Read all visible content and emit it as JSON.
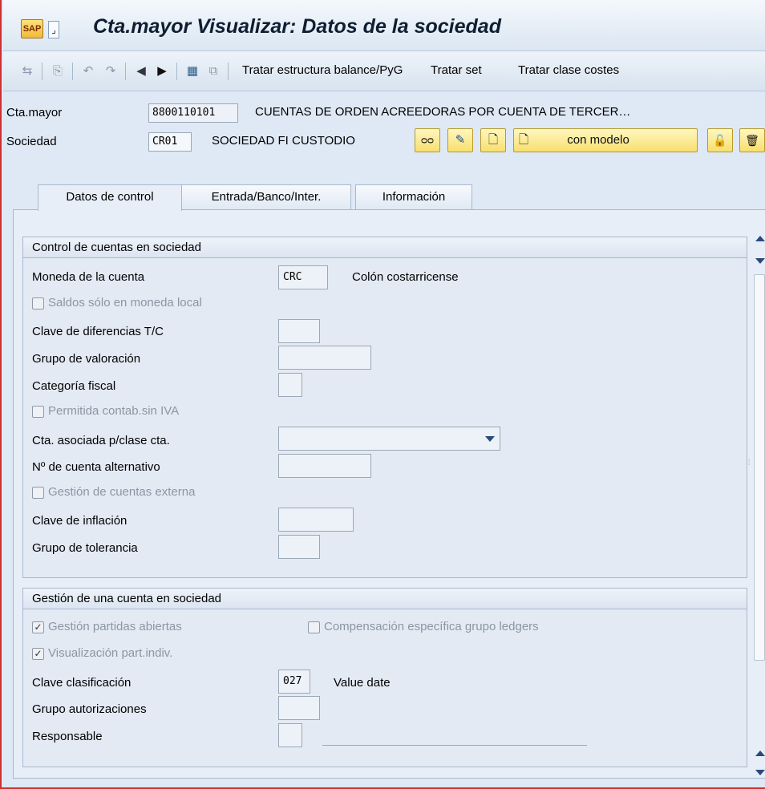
{
  "window": {
    "title_icon_text": "SAP",
    "title": "Cta.mayor Visualizar: Datos de la sociedad"
  },
  "toolbar": {
    "items": [
      "Tratar estructura balance/PyG",
      "Tratar set",
      "Tratar clase costes"
    ]
  },
  "header": {
    "account_label": "Cta.mayor",
    "account_value": "8800110101",
    "account_desc": "CUENTAS DE ORDEN ACREEDORAS POR CUENTA DE TERCER…",
    "company_label": "Sociedad",
    "company_value": "CR01",
    "company_desc": "SOCIEDAD FI CUSTODIO",
    "with_template_label": "con modelo"
  },
  "tabs": [
    {
      "label": "Datos de control"
    },
    {
      "label": "Entrada/Banco/Inter."
    },
    {
      "label": "Información"
    }
  ],
  "control_group": {
    "title": "Control de cuentas en sociedad",
    "currency_label": "Moneda de la cuenta",
    "currency_value": "CRC",
    "currency_desc": "Colón costarricense",
    "local_only_label": "Saldos sólo en moneda local",
    "exch_diff_label": "Clave de diferencias T/C",
    "valuation_label": "Grupo de valoración",
    "tax_cat_label": "Categoría fiscal",
    "no_tax_label": "Permitida contab.sin IVA",
    "recon_label": "Cta. asociada p/clase cta.",
    "alt_account_label": "Nº de cuenta alternativo",
    "ext_mgmt_label": "Gestión de cuentas externa",
    "inflation_label": "Clave de inflación",
    "tolerance_label": "Grupo de tolerancia"
  },
  "mgmt_group": {
    "title": "Gestión de una cuenta en sociedad",
    "open_items_label": "Gestión partidas abiertas",
    "open_items_checked": true,
    "ledger_comp_label": "Compensación específica grupo ledgers",
    "ledger_comp_checked": false,
    "line_items_label": "Visualización part.indiv.",
    "line_items_checked": true,
    "sort_key_label": "Clave clasificación",
    "sort_key_value": "027",
    "sort_key_desc": "Value date",
    "auth_group_label": "Grupo autorizaciones",
    "responsible_label": "Responsable"
  },
  "icons": {
    "check_mark": "✓"
  }
}
